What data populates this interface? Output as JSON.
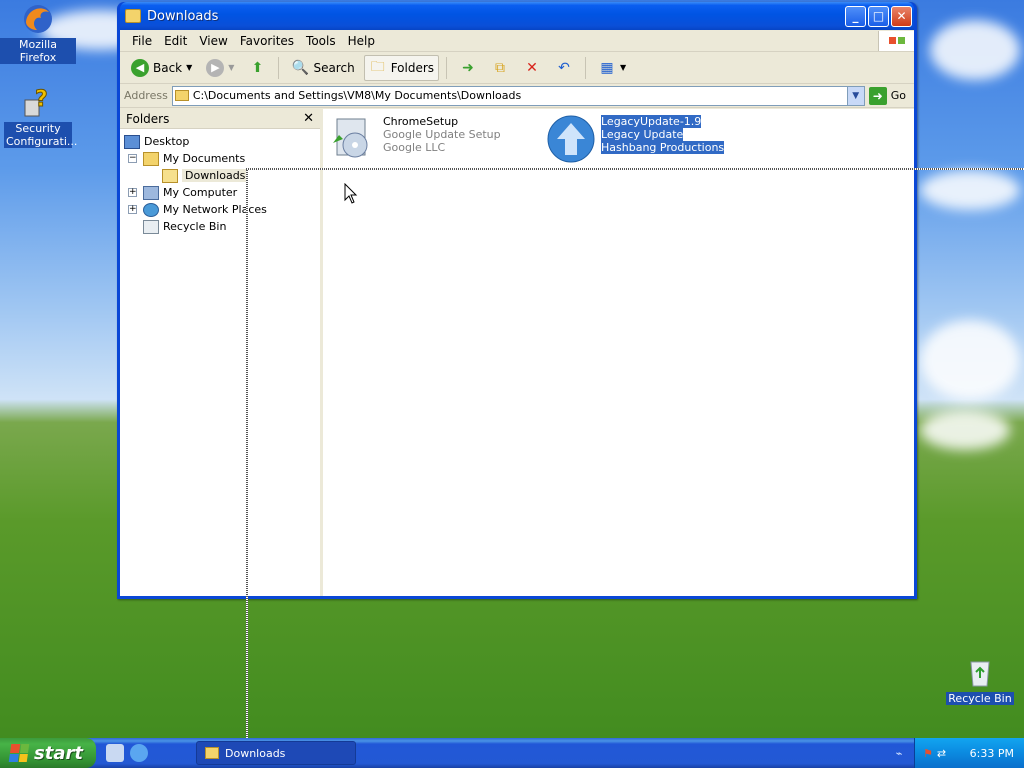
{
  "desktop": {
    "icons": [
      {
        "label": "Mozilla Firefox"
      },
      {
        "label": "Security Configurati..."
      },
      {
        "label": "Recycle Bin"
      }
    ]
  },
  "window": {
    "title": "Downloads",
    "menu": [
      "File",
      "Edit",
      "View",
      "Favorites",
      "Tools",
      "Help"
    ],
    "toolbar": {
      "back": "Back",
      "search": "Search",
      "folders": "Folders"
    },
    "address": {
      "label": "Address",
      "value": "C:\\Documents and Settings\\VM8\\My Documents\\Downloads",
      "go": "Go"
    },
    "folders_pane": {
      "title": "Folders",
      "tree": [
        {
          "label": "Desktop"
        },
        {
          "label": "My Documents"
        },
        {
          "label": "Downloads"
        },
        {
          "label": "My Computer"
        },
        {
          "label": "My Network Places"
        },
        {
          "label": "Recycle Bin"
        }
      ]
    },
    "files": [
      {
        "name": "ChromeSetup",
        "desc": "Google Update Setup",
        "company": "Google LLC"
      },
      {
        "name": "LegacyUpdate-1.9",
        "desc": "Legacy Update",
        "company": "Hashbang Productions"
      }
    ]
  },
  "taskbar": {
    "start": "start",
    "task": "Downloads",
    "clock": "6:33 PM"
  }
}
